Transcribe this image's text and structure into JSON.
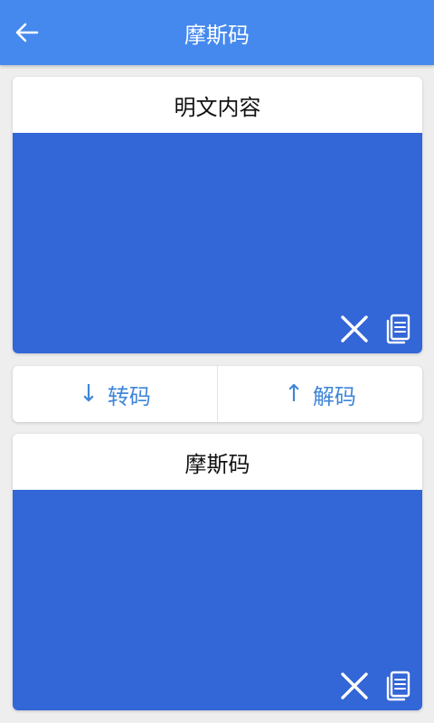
{
  "app_bar": {
    "title": "摩斯码",
    "back_icon": "arrow-left-icon"
  },
  "plain_card": {
    "title": "明文内容",
    "text_value": "",
    "clear_icon": "close-icon",
    "copy_icon": "copy-document-icon"
  },
  "actions": {
    "encode_arrow": "↓",
    "encode_label": "转码",
    "decode_arrow": "↑",
    "decode_label": "解码"
  },
  "morse_card": {
    "title": "摩斯码",
    "text_value": "",
    "clear_icon": "close-icon",
    "copy_icon": "copy-document-icon"
  },
  "colors": {
    "app_bar": "#4589ee",
    "text_area": "#3366d6",
    "action_text": "#3f86d8",
    "background": "#eeeeee"
  }
}
